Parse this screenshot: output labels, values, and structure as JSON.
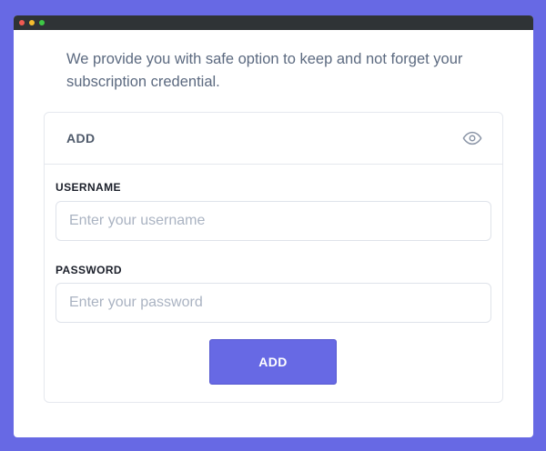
{
  "window": {
    "controls": [
      "close",
      "minimize",
      "maximize"
    ]
  },
  "intro": {
    "text": "We provide you with safe option to keep and not forget your subscription credential."
  },
  "card": {
    "title": "ADD",
    "visibility_icon": "eye-icon"
  },
  "form": {
    "username": {
      "label": "USERNAME",
      "value": "",
      "placeholder": "Enter your username"
    },
    "password": {
      "label": "PASSWORD",
      "value": "",
      "placeholder": "Enter your password"
    },
    "submit_label": "ADD"
  },
  "colors": {
    "background": "#6769e4",
    "accent": "#6769e4",
    "titlebar": "#2f3336",
    "close": "#ef5a52",
    "minimize": "#f4bc2f",
    "maximize": "#3ec846"
  }
}
